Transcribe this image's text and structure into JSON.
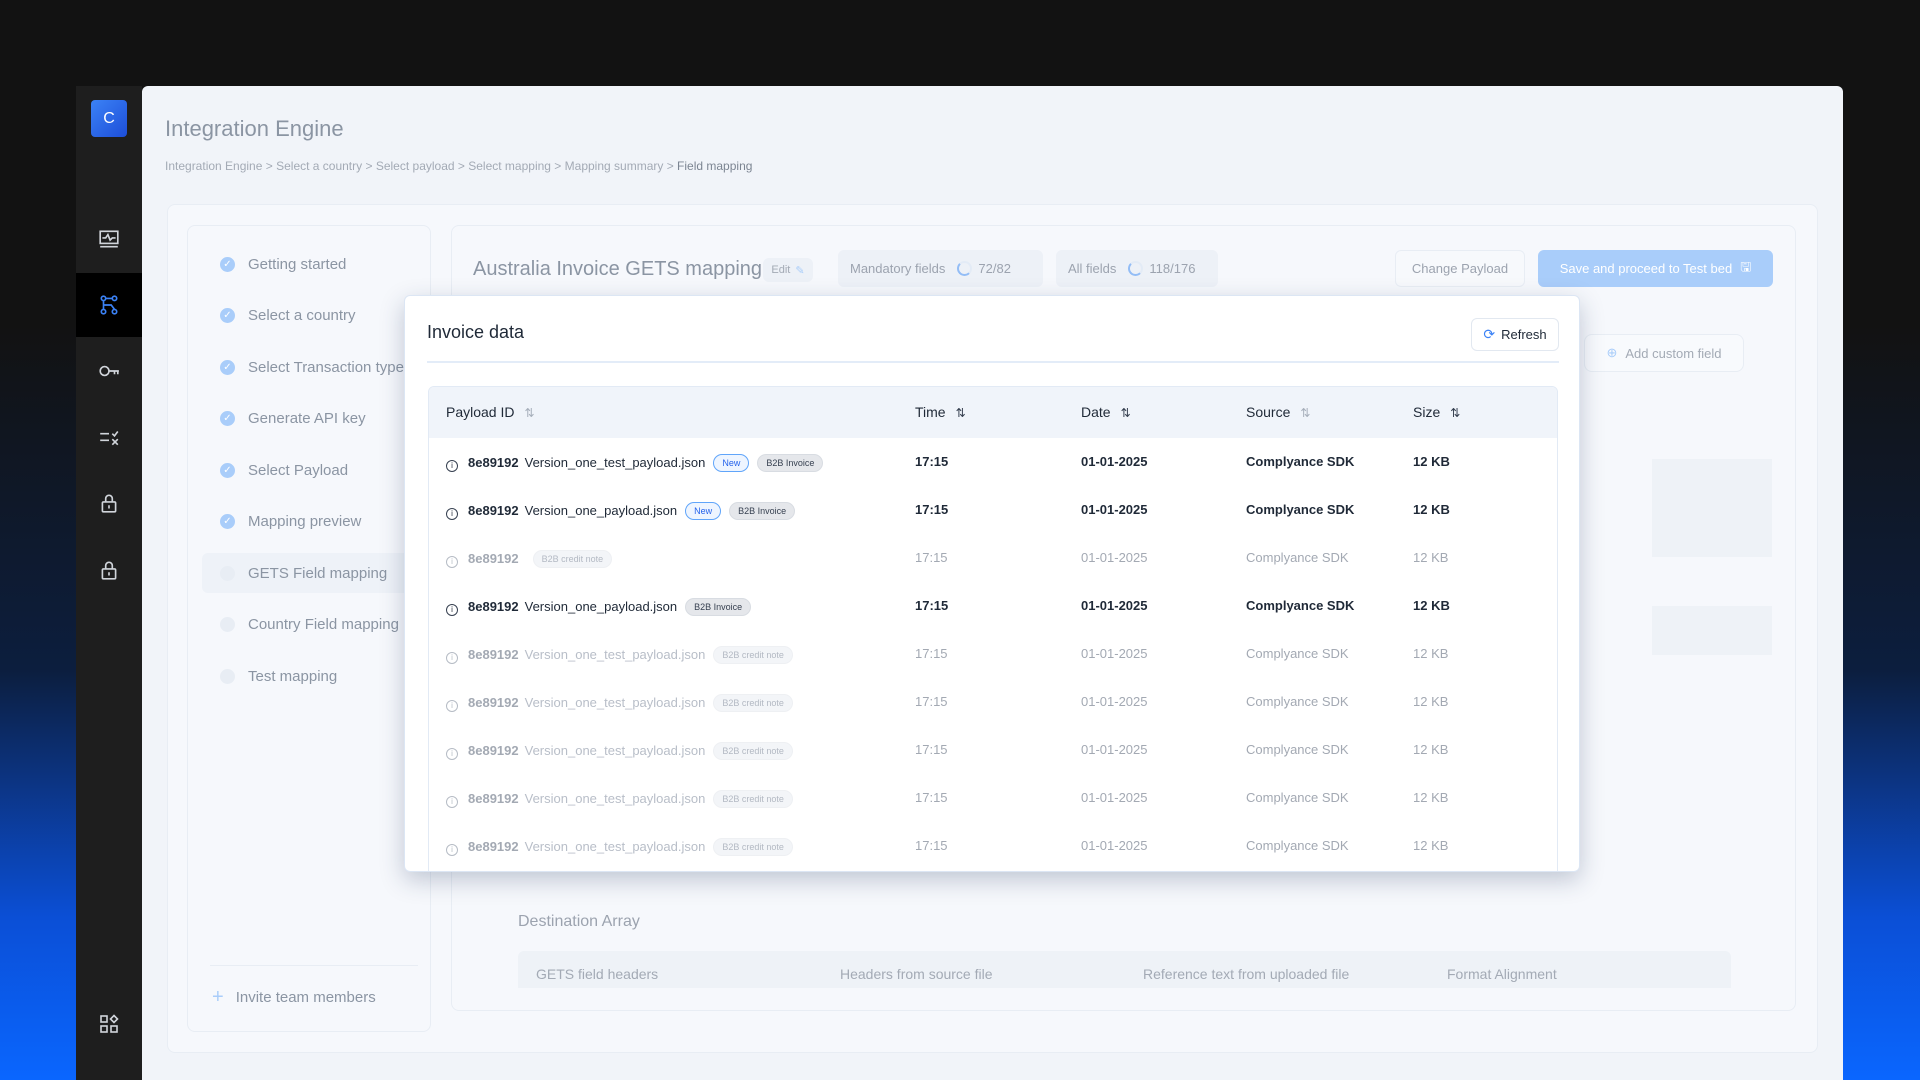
{
  "app": {
    "logo_letter": "C",
    "title": "Integration Engine",
    "breadcrumb": [
      "Integration Engine",
      "Select a country",
      "Select payload",
      "Select mapping",
      "Mapping summary"
    ],
    "breadcrumb_current": "Field mapping"
  },
  "rail": [
    {
      "icon": "activity-monitor-icon"
    },
    {
      "icon": "workflow-icon",
      "active": true
    },
    {
      "icon": "key-icon"
    },
    {
      "icon": "checklist-icon"
    },
    {
      "icon": "lock-icon"
    },
    {
      "icon": "lock-icon"
    }
  ],
  "rail_bottom_icon": "apps-grid-icon",
  "steps": [
    {
      "label": "Getting started",
      "done": true
    },
    {
      "label": "Select a country",
      "done": true
    },
    {
      "label": "Select Transaction type",
      "done": true
    },
    {
      "label": "Generate API key",
      "done": true
    },
    {
      "label": "Select Payload",
      "done": true
    },
    {
      "label": "Mapping preview",
      "done": true
    },
    {
      "label": "GETS Field mapping",
      "done": false,
      "current": true
    },
    {
      "label": "Country Field mapping",
      "done": false
    },
    {
      "label": "Test mapping",
      "done": false
    }
  ],
  "invite_label": "Invite team members",
  "header": {
    "title": "Australia Invoice GETS mapping",
    "edit_label": "Edit",
    "mandatory_label": "Mandatory fields",
    "mandatory_value": "72/82",
    "mandatory_progress": 0.88,
    "all_label": "All fields",
    "all_value": "118/176",
    "all_progress": 0.67,
    "change_payload": "Change Payload",
    "save": "Save and proceed to Test bed",
    "add_custom": "Add custom field"
  },
  "destination": {
    "title": "Destination Array",
    "columns": [
      "GETS field headers",
      "Headers from source file",
      "Reference text from uploaded file",
      "Format Alignment"
    ]
  },
  "modal": {
    "title": "Invoice data",
    "refresh": "Refresh",
    "columns": [
      "Payload ID",
      "Time",
      "Date",
      "Source",
      "Size"
    ],
    "rows": [
      {
        "id": "8e89192",
        "name": "Version_one_test_payload.json",
        "tags": [
          "New",
          "B2B Invoice"
        ],
        "time": "17:15",
        "date": "01-01-2025",
        "source": "Complyance SDK",
        "size": "12 KB",
        "enabled": true
      },
      {
        "id": "8e89192",
        "name": "Version_one_payload.json",
        "tags": [
          "New",
          "B2B Invoice"
        ],
        "time": "17:15",
        "date": "01-01-2025",
        "source": "Complyance SDK",
        "size": "12 KB",
        "enabled": true
      },
      {
        "id": "8e89192",
        "name": "",
        "tags": [
          "B2B credit note"
        ],
        "time": "17:15",
        "date": "01-01-2025",
        "source": "Complyance SDK",
        "size": "12 KB",
        "enabled": false
      },
      {
        "id": "8e89192",
        "name": "Version_one_payload.json",
        "tags": [
          "B2B Invoice"
        ],
        "time": "17:15",
        "date": "01-01-2025",
        "source": "Complyance SDK",
        "size": "12 KB",
        "enabled": true
      },
      {
        "id": "8e89192",
        "name": "Version_one_test_payload.json",
        "tags": [
          "B2B credit note"
        ],
        "time": "17:15",
        "date": "01-01-2025",
        "source": "Complyance SDK",
        "size": "12 KB",
        "enabled": false
      },
      {
        "id": "8e89192",
        "name": "Version_one_test_payload.json",
        "tags": [
          "B2B credit note"
        ],
        "time": "17:15",
        "date": "01-01-2025",
        "source": "Complyance SDK",
        "size": "12 KB",
        "enabled": false
      },
      {
        "id": "8e89192",
        "name": "Version_one_test_payload.json",
        "tags": [
          "B2B credit note"
        ],
        "time": "17:15",
        "date": "01-01-2025",
        "source": "Complyance SDK",
        "size": "12 KB",
        "enabled": false
      },
      {
        "id": "8e89192",
        "name": "Version_one_test_payload.json",
        "tags": [
          "B2B credit note"
        ],
        "time": "17:15",
        "date": "01-01-2025",
        "source": "Complyance SDK",
        "size": "12 KB",
        "enabled": false
      },
      {
        "id": "8e89192",
        "name": "Version_one_test_payload.json",
        "tags": [
          "B2B credit note"
        ],
        "time": "17:15",
        "date": "01-01-2025",
        "source": "Complyance SDK",
        "size": "12 KB",
        "enabled": false
      }
    ]
  },
  "colors": {
    "accent": "#3b82f6",
    "save_button": "#a9cdfa",
    "rail": "#1e1e1e"
  }
}
